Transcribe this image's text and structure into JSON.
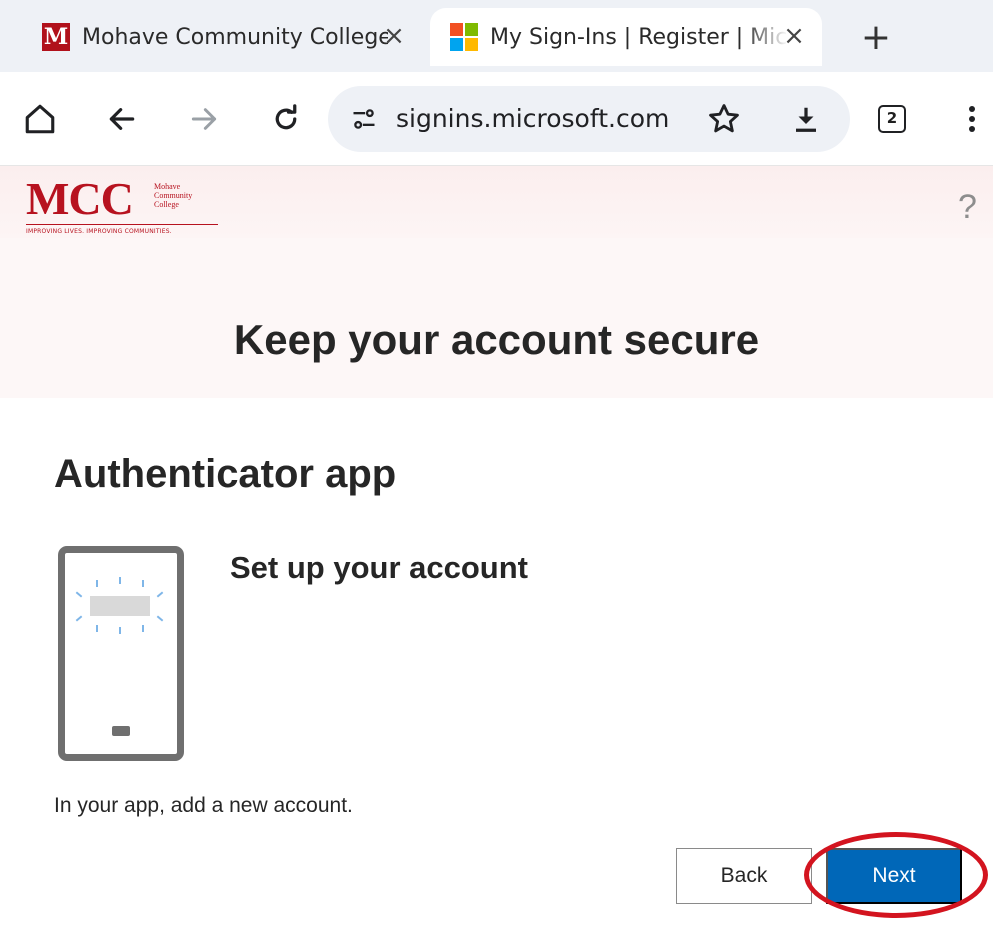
{
  "browser": {
    "tabs": [
      {
        "title": "Mohave Community College",
        "favicon": "mcc-m-favicon",
        "active": false
      },
      {
        "title": "My Sign-Ins | Register | Microsoft",
        "favicon": "microsoft-favicon",
        "active": true
      }
    ],
    "new_tab_icon": "plus-icon",
    "url": "signins.microsoft.com",
    "tab_count": "2"
  },
  "header": {
    "logo_text": "MCC",
    "logo_name_line1": "Mohave",
    "logo_name_line2": "Community",
    "logo_name_line3": "College",
    "logo_tagline": "IMPROVING LIVES. IMPROVING COMMUNITIES.",
    "help_label": "?"
  },
  "page": {
    "title": "Keep your account secure",
    "section_title": "Authenticator app",
    "step_title": "Set up your account",
    "instruction": "In your app, add a new account.",
    "back_label": "Back",
    "next_label": "Next"
  },
  "colors": {
    "brand_red": "#b7121f",
    "primary_button": "#0067b8",
    "highlight_ring": "#d3141f"
  }
}
